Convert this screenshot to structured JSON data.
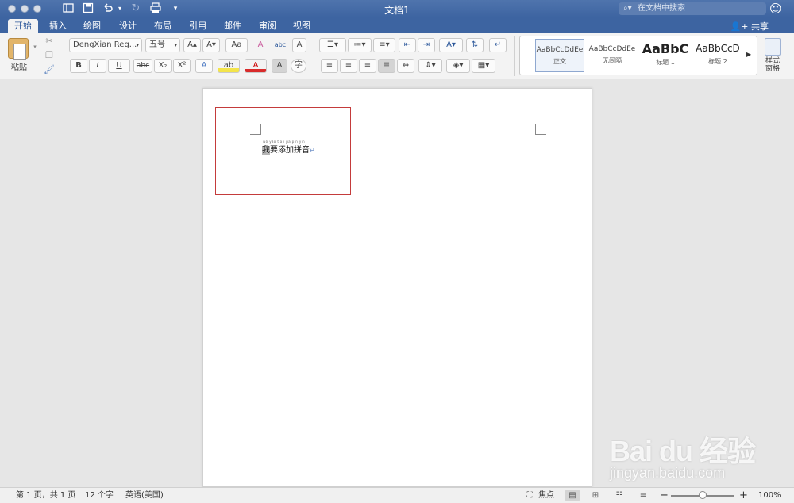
{
  "titlebar": {
    "title": "文档1",
    "search_placeholder": "在文档中搜索",
    "qat": [
      "sidebar-icon",
      "save-icon",
      "undo-icon",
      "redo-icon",
      "print-icon",
      "customize-icon"
    ]
  },
  "tabs": [
    {
      "label": "开始",
      "active": true
    },
    {
      "label": "插入"
    },
    {
      "label": "绘图"
    },
    {
      "label": "设计"
    },
    {
      "label": "布局"
    },
    {
      "label": "引用"
    },
    {
      "label": "邮件"
    },
    {
      "label": "审阅"
    },
    {
      "label": "视图"
    }
  ],
  "share_label": "共享",
  "ribbon": {
    "paste_label": "粘贴",
    "font_name": "DengXian Reg...",
    "font_size": "五号",
    "format": {
      "bold": "B",
      "italic": "I",
      "underline": "U",
      "strike": "abc",
      "subscript": "X₂",
      "superscript": "X²",
      "grow": "A▴",
      "shrink": "A▾",
      "case": "Aa",
      "clear": "A",
      "phonetic": "abc",
      "border_char": "A",
      "effects": "A",
      "highlight": "ab",
      "font_color": "A",
      "shading": "A",
      "enclose": "字"
    },
    "styles": [
      {
        "sample": "AaBbCcDdEe",
        "name": "正文",
        "selected": true
      },
      {
        "sample": "AaBbCcDdEe",
        "name": "无间隔"
      },
      {
        "sample": "AaBbC",
        "name": "标题 1"
      },
      {
        "sample": "AaBbCcD",
        "name": "标题 2"
      }
    ],
    "styles_pane_label": "样式\n窗格"
  },
  "document": {
    "ruby_text": "wǒ yào tiān jiā pīn yīn",
    "selected_char": "我",
    "rest_text": "要添加拼音",
    "paragraph_mark": "↵"
  },
  "statusbar": {
    "page": "第 1 页，共 1 页",
    "words": "12 个字",
    "language": "英语(美国)",
    "focus_label": "焦点",
    "zoom_minus": "−",
    "zoom_plus": "+",
    "zoom": "100%",
    "zoom_fraction": 0.5
  },
  "watermark": {
    "logo": "Bai du 经验",
    "url": "jingyan.baidu.com"
  },
  "colors": {
    "titlebar": "#3d64a1",
    "highlight_box": "#c43b3b"
  }
}
